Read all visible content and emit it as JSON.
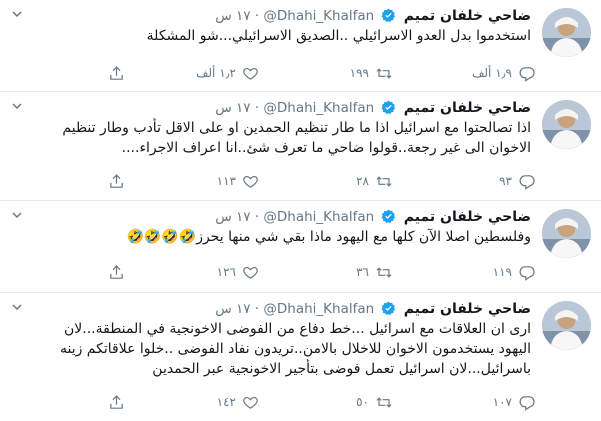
{
  "tweets": [
    {
      "name": "ضاحي خلفان تميم",
      "handle": "@Dhahi_Khalfan",
      "time": "١٧ س",
      "lines": [
        "استخدموا بدل العدو الاسرائيلي ..الصديق الاسرائيلي...شو المشكلة"
      ],
      "reply": "١٫٩ ألف",
      "retweet": "١٩٩",
      "like": "١٫٢ ألف"
    },
    {
      "name": "ضاحي خلفان تميم",
      "handle": "@Dhahi_Khalfan",
      "time": "١٧ س",
      "lines": [
        "اذا تصالحتوا مع اسرائيل اذا ما طار تنظيم الحمدين او على الاقل تأدب وطار تنظيم",
        "الاخوان الى غير رجعة..قولوا ضاحي ما تعرف شئ..انا اعراف الاجراء...."
      ],
      "reply": "٩٣",
      "retweet": "٢٨",
      "like": "١١٣"
    },
    {
      "name": "ضاحي خلفان تميم",
      "handle": "@Dhahi_Khalfan",
      "time": "١٧ س",
      "lines": [
        "وفلسطين اصلا الآن كلها مع اليهود ماذا بقي شي منها يحرز🤣🤣🤣🤣"
      ],
      "reply": "١١٩",
      "retweet": "٣٦",
      "like": "١٢٦"
    },
    {
      "name": "ضاحي خلفان تميم",
      "handle": "@Dhahi_Khalfan",
      "time": "١٧ س",
      "lines": [
        "ارى ان العلاقات مع اسرائيل ...خط دفاع من الفوضى الاخونجية في المنطقة...لان",
        "اليهود يستخدمون الاخوان للاخلال بالامن..تريدون نفاد الفوضى ..خلوا علاقاتكم زينه",
        "باسرائيل...لان اسرائيل تعمل فوضى بتأجير الاخونجية عبر الحمدين"
      ],
      "reply": "١٠٧",
      "retweet": "٥٠",
      "like": "١٤٢"
    }
  ],
  "colors": {
    "verified": "#1da1f2",
    "muted": "#657786",
    "divider": "#e6ecf0"
  }
}
